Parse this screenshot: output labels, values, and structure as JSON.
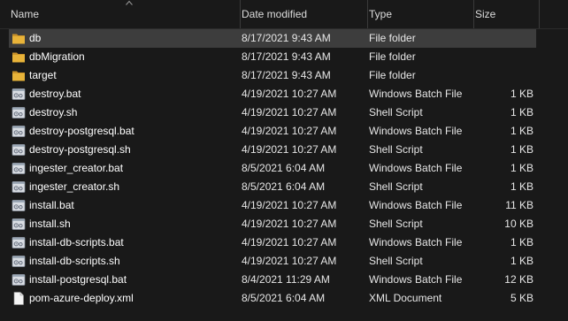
{
  "columns": {
    "name": "Name",
    "date_modified": "Date modified",
    "type": "Type",
    "size": "Size"
  },
  "colors": {
    "background": "#191919",
    "selected_row": "#3d3d3d",
    "folder": "#e8b339"
  },
  "files": [
    {
      "name": "db",
      "date": "8/17/2021 9:43 AM",
      "type": "File folder",
      "size": "",
      "icon": "folder-icon"
    },
    {
      "name": "dbMigration",
      "date": "8/17/2021 9:43 AM",
      "type": "File folder",
      "size": "",
      "icon": "folder-icon"
    },
    {
      "name": "target",
      "date": "8/17/2021 9:43 AM",
      "type": "File folder",
      "size": "",
      "icon": "folder-icon"
    },
    {
      "name": "destroy.bat",
      "date": "4/19/2021 10:27 AM",
      "type": "Windows Batch File",
      "size": "1 KB",
      "icon": "batch-file-icon"
    },
    {
      "name": "destroy.sh",
      "date": "4/19/2021 10:27 AM",
      "type": "Shell Script",
      "size": "1 KB",
      "icon": "script-file-icon"
    },
    {
      "name": "destroy-postgresql.bat",
      "date": "4/19/2021 10:27 AM",
      "type": "Windows Batch File",
      "size": "1 KB",
      "icon": "batch-file-icon"
    },
    {
      "name": "destroy-postgresql.sh",
      "date": "4/19/2021 10:27 AM",
      "type": "Shell Script",
      "size": "1 KB",
      "icon": "script-file-icon"
    },
    {
      "name": "ingester_creator.bat",
      "date": "8/5/2021 6:04 AM",
      "type": "Windows Batch File",
      "size": "1 KB",
      "icon": "batch-file-icon"
    },
    {
      "name": "ingester_creator.sh",
      "date": "8/5/2021 6:04 AM",
      "type": "Shell Script",
      "size": "1 KB",
      "icon": "script-file-icon"
    },
    {
      "name": "install.bat",
      "date": "4/19/2021 10:27 AM",
      "type": "Windows Batch File",
      "size": "11 KB",
      "icon": "batch-file-icon"
    },
    {
      "name": "install.sh",
      "date": "4/19/2021 10:27 AM",
      "type": "Shell Script",
      "size": "10 KB",
      "icon": "script-file-icon"
    },
    {
      "name": "install-db-scripts.bat",
      "date": "4/19/2021 10:27 AM",
      "type": "Windows Batch File",
      "size": "1 KB",
      "icon": "batch-file-icon"
    },
    {
      "name": "install-db-scripts.sh",
      "date": "4/19/2021 10:27 AM",
      "type": "Shell Script",
      "size": "1 KB",
      "icon": "script-file-icon"
    },
    {
      "name": "install-postgresql.bat",
      "date": "8/4/2021 11:29 AM",
      "type": "Windows Batch File",
      "size": "12 KB",
      "icon": "batch-file-icon"
    },
    {
      "name": "pom-azure-deploy.xml",
      "date": "8/5/2021 6:04 AM",
      "type": "XML Document",
      "size": "5 KB",
      "icon": "xml-file-icon"
    }
  ]
}
